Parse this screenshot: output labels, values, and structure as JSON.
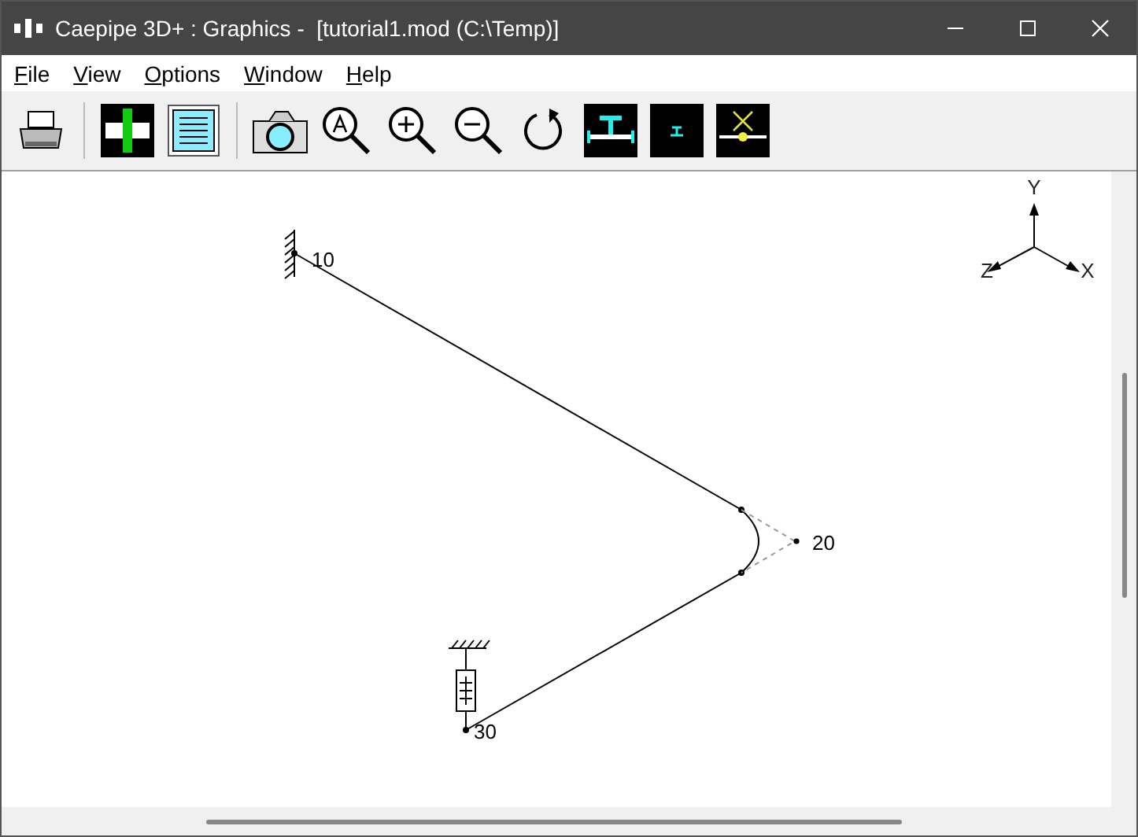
{
  "window": {
    "title": "Caepipe 3D+ : Graphics -  [tutorial1.mod (C:\\Temp)]"
  },
  "menu": [
    {
      "label": "File"
    },
    {
      "label": "View"
    },
    {
      "label": "Options"
    },
    {
      "label": "Window"
    },
    {
      "label": "Help"
    }
  ],
  "canvas": {
    "nodes": [
      {
        "label": "10"
      },
      {
        "label": "20"
      },
      {
        "label": "30"
      }
    ],
    "axes": [
      {
        "label": "Y"
      },
      {
        "label": "Z"
      },
      {
        "label": "X"
      }
    ]
  }
}
